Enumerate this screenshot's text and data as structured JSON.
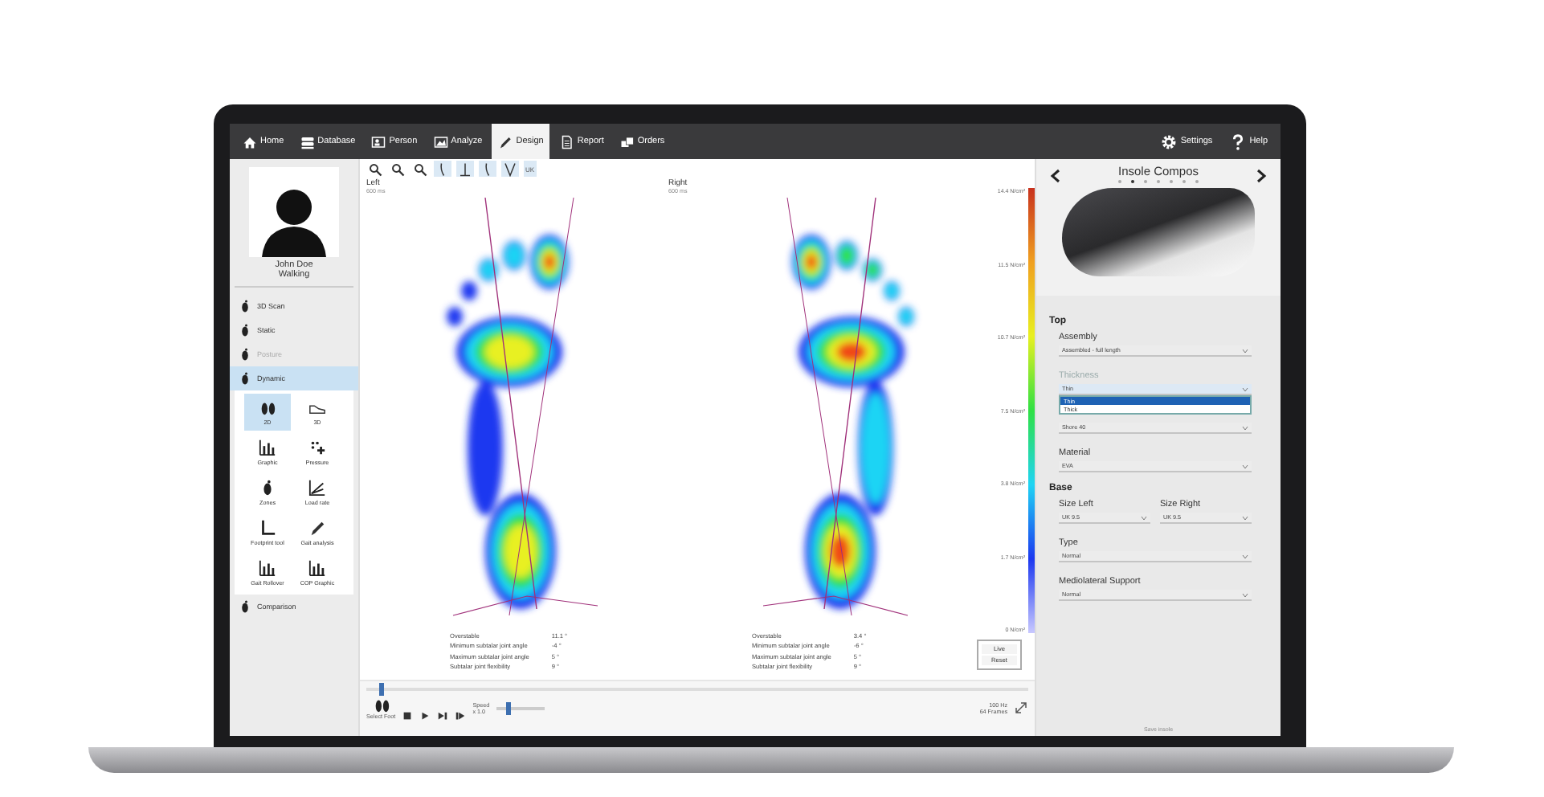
{
  "nav": {
    "items": [
      {
        "label": "Home",
        "selected": false
      },
      {
        "label": "Database",
        "selected": false
      },
      {
        "label": "Person",
        "selected": false
      },
      {
        "label": "Analyze",
        "selected": false
      },
      {
        "label": "Design",
        "selected": true
      },
      {
        "label": "Report",
        "selected": false
      },
      {
        "label": "Orders",
        "selected": false
      }
    ],
    "right_items": [
      {
        "label": "Settings"
      },
      {
        "label": "Help"
      }
    ]
  },
  "sidebar": {
    "name": "John Doe",
    "activity": "Walking",
    "modes": [
      {
        "label": "3D Scan",
        "selected": false,
        "disabled": false
      },
      {
        "label": "Static",
        "selected": false,
        "disabled": false
      },
      {
        "label": "Posture",
        "selected": false,
        "disabled": true
      },
      {
        "label": "Dynamic",
        "selected": true,
        "disabled": false
      }
    ],
    "tiles": [
      {
        "label": "2D",
        "selected": true
      },
      {
        "label": "3D",
        "selected": false
      },
      {
        "label": "Graphic",
        "selected": false
      },
      {
        "label": "Pressure",
        "selected": false
      },
      {
        "label": "Zones",
        "selected": false
      },
      {
        "label": "Load rate",
        "selected": false
      },
      {
        "label": "Footprint tool",
        "selected": false
      },
      {
        "label": "Gait analysis",
        "selected": false
      },
      {
        "label": "Gait Rollover",
        "selected": false
      },
      {
        "label": "COP Graphic",
        "selected": false
      }
    ],
    "bottom": "Comparison"
  },
  "viewer": {
    "tool_label": "UK",
    "feet": [
      {
        "label": "Left",
        "sublabel": "600 ms"
      },
      {
        "label": "Right",
        "sublabel": "600 ms"
      }
    ],
    "scale": [
      "14.4 N/cm²",
      "11.5 N/cm²",
      "10.7 N/cm²",
      "7.5 N/cm²",
      "3.8 N/cm²",
      "1.7 N/cm²",
      "0 N/cm²"
    ],
    "metrics": [
      [
        {
          "label": "Overstable",
          "value": "11.1 °"
        },
        {
          "label": "Minimum subtalar joint angle",
          "value": "-4 °"
        },
        {
          "label": "Maximum subtalar joint angle",
          "value": "5 °"
        },
        {
          "label": "Subtalar joint flexibility",
          "value": "9 °"
        }
      ],
      [
        {
          "label": "Overstable",
          "value": "3.4 °"
        },
        {
          "label": "Minimum subtalar joint angle",
          "value": "-6 °"
        },
        {
          "label": "Maximum subtalar joint angle",
          "value": "5 °"
        },
        {
          "label": "Subtalar joint flexibility",
          "value": "9 °"
        }
      ]
    ],
    "buttons": [
      "Live",
      "Reset"
    ]
  },
  "playback": {
    "select_foot": "Select Foot",
    "speed_label": "Speed",
    "speed_value": "x 1.0",
    "timeline": {
      "level": 0.02
    },
    "speed": {
      "level": 0.2
    },
    "rate": "100 Hz",
    "frames": "64 Frames"
  },
  "panel": {
    "title": "Insole Compos",
    "sections": [
      {
        "title": "Top",
        "fields": [
          {
            "kind": "full",
            "label": "Assembly",
            "value": "Assembled - full length",
            "disabled": false
          },
          {
            "kind": "full",
            "label": "Thickness",
            "value": "Thin",
            "disabled": true,
            "options": [
              {
                "label": "Thin",
                "selected": true
              },
              {
                "label": "Thick",
                "selected": false
              }
            ]
          },
          {
            "kind": "full",
            "value": "Shore 40",
            "disabled": false
          },
          {
            "kind": "full",
            "label": "Material",
            "value": "EVA",
            "disabled": false
          }
        ]
      },
      {
        "title": "Base",
        "fields": [
          {
            "kind": "half",
            "label": "Size Left",
            "value": "UK 9.5",
            "disabled": false
          },
          {
            "kind": "half",
            "label": "Size Right",
            "value": "UK 9.5",
            "disabled": false
          },
          {
            "kind": "full",
            "label": "Type",
            "value": "Normal",
            "disabled": false
          },
          {
            "kind": "full",
            "label": "Mediolateral Support",
            "value": "Normal",
            "disabled": false
          }
        ]
      }
    ],
    "footer": "Save insole"
  }
}
